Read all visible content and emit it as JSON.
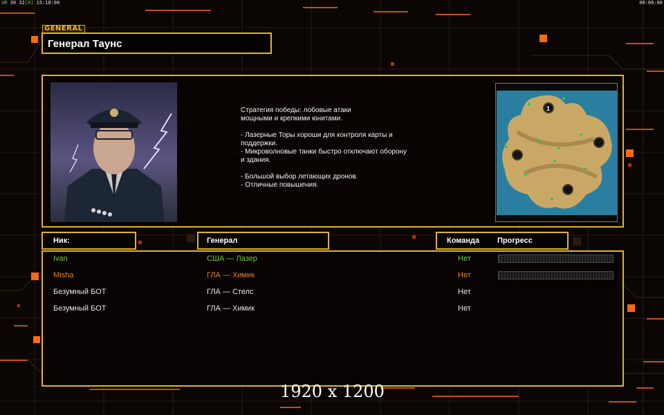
{
  "hud": {
    "left_prefix": "UR",
    "left_fps": "30 32",
    "left_extra": "[0]",
    "left_time": "15:18:00",
    "right_time": "00:00:00"
  },
  "general": {
    "tag": "GENERAL",
    "name": "Генерал Таунс"
  },
  "description": {
    "p1": "Стратегия победы: лобовые атаки\nмощными и крепкими юнитами.",
    "p2": "- Лазерные Торы хороши для контроля карты и\n поддержки.\n- Микроволновые танки быстро отключают оборону\n и здания.",
    "p3": "- Большой выбор летающих дронов.\n- Отличные повышения."
  },
  "map": {
    "slot_label": "1"
  },
  "columns": {
    "nick": "Ник:",
    "general": "Генерал",
    "team": "Команда",
    "progress": "Прогресс"
  },
  "players": [
    {
      "nick": "Ivan",
      "general": "США — Лазер",
      "team": "Нет",
      "color": "#72c93a",
      "progress": 0,
      "show_progress": true
    },
    {
      "nick": "Misha",
      "general": "ГЛА — Химик",
      "team": "Нет",
      "color": "#e2832a",
      "progress": 0,
      "show_progress": true
    },
    {
      "nick": "Безумный БОТ",
      "general": "ГЛА — Стелс",
      "team": "Нет",
      "color": "#e6e6e6",
      "show_progress": false
    },
    {
      "nick": "Безумный БОТ",
      "general": "ГЛА — Химик",
      "team": "Нет",
      "color": "#e6e6e6",
      "show_progress": false
    }
  ],
  "watermark": "1920 x 1200",
  "colors": {
    "frame": "#e3b523",
    "accent_orange": "#ff6a10",
    "player1": "#72c93a",
    "player2": "#e2832a"
  }
}
